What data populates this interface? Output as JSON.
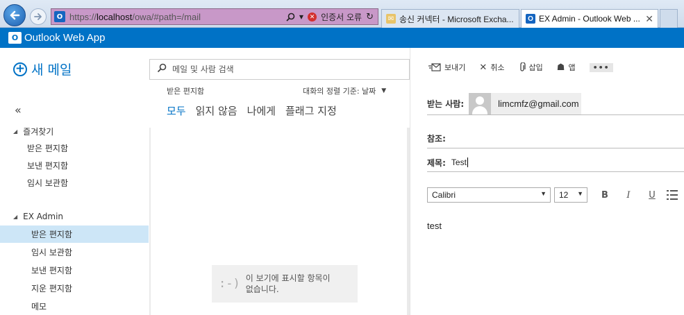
{
  "browser": {
    "url_prefix": "https://",
    "url_host": "localhost",
    "url_path": "/owa/#path=/mail",
    "cert_error": "인증서 오류",
    "tabs": [
      {
        "label": "송신 커넥터 - Microsoft Excha...",
        "active": false
      },
      {
        "label": "EX Admin - Outlook Web ...",
        "active": true
      }
    ]
  },
  "app": {
    "title": "Outlook Web App",
    "accent": "#0072c6"
  },
  "leftnav": {
    "new_mail": "새 메일",
    "collapse_glyph": "«",
    "favorites": {
      "label": "즐겨찾기",
      "items": [
        "받은 편지함",
        "보낸 편지함",
        "임시 보관함"
      ]
    },
    "account": {
      "label": "EX Admin",
      "items": [
        "받은 편지함",
        "임시 보관함",
        "보낸 편지함",
        "지운 편지함",
        "메모"
      ],
      "selected": "받은 편지함"
    }
  },
  "list": {
    "search_placeholder": "메일 및 사람 검색",
    "folder": "받은 편지함",
    "sort": "대화의 정렬 기준: 날짜",
    "filters": [
      "모두",
      "읽지 않음",
      "나에게",
      "플래그 지정"
    ],
    "empty_face": ":-)",
    "empty_line1": "이 보기에 표시할 항목이",
    "empty_line2": "없습니다."
  },
  "compose": {
    "toolbar": {
      "send": "보내기",
      "discard": "취소",
      "insert": "삽입",
      "apps": "앱",
      "more": "•••"
    },
    "to_label": "받는 사람:",
    "to_email": "limcmfz@gmail.com",
    "cc_label": "참조:",
    "subject_label": "제목:",
    "subject_value": "Test",
    "font": "Calibri",
    "size": "12",
    "bold": "B",
    "italic": "I",
    "underline": "U",
    "body": "test"
  }
}
